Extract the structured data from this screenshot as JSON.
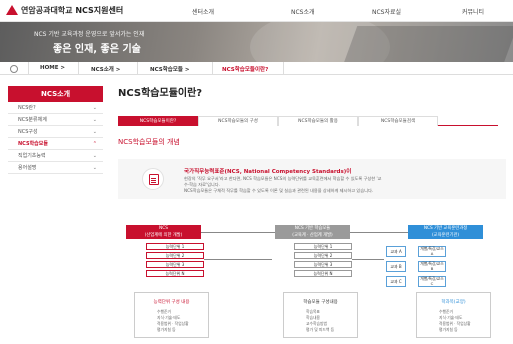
{
  "header": {
    "logo_text": "연암공과대학교",
    "site_title": "NCS지원센터",
    "nav": [
      "센터소개",
      "NCS소개",
      "NCS자료실",
      "커뮤니티"
    ],
    "brand_color": "#c8102e"
  },
  "banner": {
    "subtitle": "NCS 기반 교육과정 운영으로 앞서가는 인재",
    "title": "좋은 인재, 좋은 기술"
  },
  "breadcrumb": {
    "home_icon": "home-icon",
    "items": [
      "HOME >",
      "NCS소개 >",
      "NCS학습모듈 >",
      "NCS학습모듈이란?"
    ]
  },
  "sidebar": {
    "title": "NCS소개",
    "items": [
      {
        "label": "NCS란?",
        "chevron": "⌄",
        "active": false
      },
      {
        "label": "NCS분류체계",
        "chevron": "⌄",
        "active": false
      },
      {
        "label": "NCS구성",
        "chevron": "⌄",
        "active": false
      },
      {
        "label": "NCS학습모듈",
        "chevron": "⌃",
        "active": true
      },
      {
        "label": "직업기초능력",
        "chevron": "⌄",
        "active": false
      },
      {
        "label": "용어설명",
        "chevron": "⌄",
        "active": false
      }
    ]
  },
  "main": {
    "title": "NCS학습모듈이란?",
    "tabs": [
      {
        "label": "NCS학습모듈이란?",
        "active": true
      },
      {
        "label": "NCS학습모듈의 구성",
        "active": false
      },
      {
        "label": "NCS학습모듈의 활용",
        "active": false
      },
      {
        "label": "NCS학습모듈검색",
        "active": false
      }
    ],
    "section_title": "NCS학습모듈의 개념",
    "definition": {
      "icon": "document-icon",
      "title": "국가직무능력표준(NCS, National Competency Standards)이",
      "lines": [
        "현장의 '직무 요구서'라고 한다면, NCS 학습모듈은 NCS의 능력단위를 교육훈련에서 학습할 수 있도록 구성한 '교",
        "수·학습 자료'입니다.",
        "NCS학습모듈은 구체적 직무를 학습할 수 있도록 이론 및 실습과 관련된 내용을 상세하게 제시하고 있습니다."
      ]
    }
  },
  "diagram": {
    "columns": [
      {
        "line1": "NCS",
        "line2": "(산업계에 의한 개발)",
        "color": "#c8102e"
      },
      {
        "line1": "NCS 기반 학습모듈",
        "line2": "(교육계 · 산업계 개발)",
        "color": "#9a9a9a"
      },
      {
        "line1": "NCS 기반 교육훈련과정",
        "line2": "(교육훈련기관)",
        "color": "#2f8fd8"
      }
    ],
    "ncs_units": [
      "능력단위 1",
      "능력단위 2",
      "능력단위 3",
      "능력단위 N"
    ],
    "module_units": [
      "능력단위 1",
      "능력단위 2",
      "능력단위 3",
      "능력단위 N"
    ],
    "courses": [
      "교과 A",
      "교과 B",
      "교과 C"
    ],
    "subjects": [
      "개별/특강/교스 A",
      "개별/특강/교스 B",
      "개별/특강/교스 C"
    ],
    "boxes": [
      {
        "title": "능력단위 구성 내용",
        "title_color": "#c8102e",
        "items": [
          "수행준거",
          "지식·기술·태도",
          "적용범위 · 작업상황",
          "평가지침 등"
        ]
      },
      {
        "title": "학습모듈 구성내용",
        "title_color": "#333333",
        "items": [
          "학습목표",
          "학습내용",
          "교수학습방법",
          "평가 및 피드백 등"
        ]
      },
      {
        "title": "학과목(교양)",
        "title_color": "#2f8fd8",
        "items": [
          "수행준거",
          "지식·기술·태도",
          "적용범위 · 작업상황",
          "평가지침 등"
        ]
      }
    ]
  }
}
